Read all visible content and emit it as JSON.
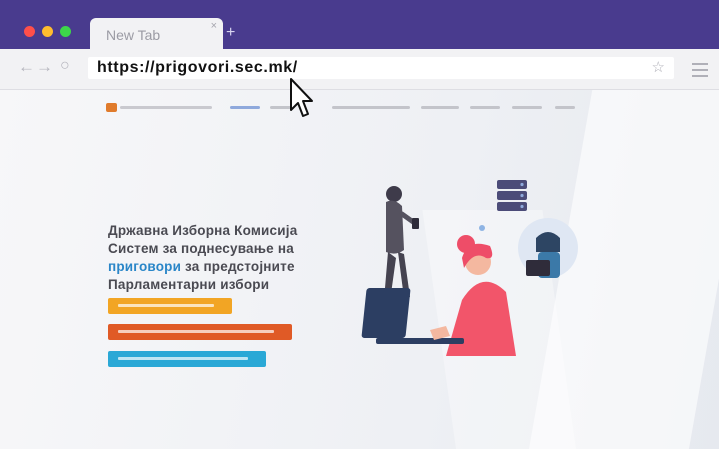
{
  "browser": {
    "tab_title": "New Tab",
    "tab_close": "×",
    "new_tab": "+",
    "back": "←",
    "forward": "→",
    "reload": "○",
    "url": "https://prigovori.sec.mk/",
    "bookmark": "☆"
  },
  "page": {
    "headline_line1": "Државна Изборна Комисија",
    "headline_line2": "Систем за поднесување на",
    "headline_highlight": "приговори",
    "headline_line3_rest": " за предстојните",
    "headline_line4": "Парламентарни избори"
  },
  "colors": {
    "titlebar": "#493b8e",
    "accent_blue": "#2a86c8",
    "button_yellow": "#f2a524",
    "button_orange": "#e05a26",
    "button_blue": "#2aa8d6"
  }
}
